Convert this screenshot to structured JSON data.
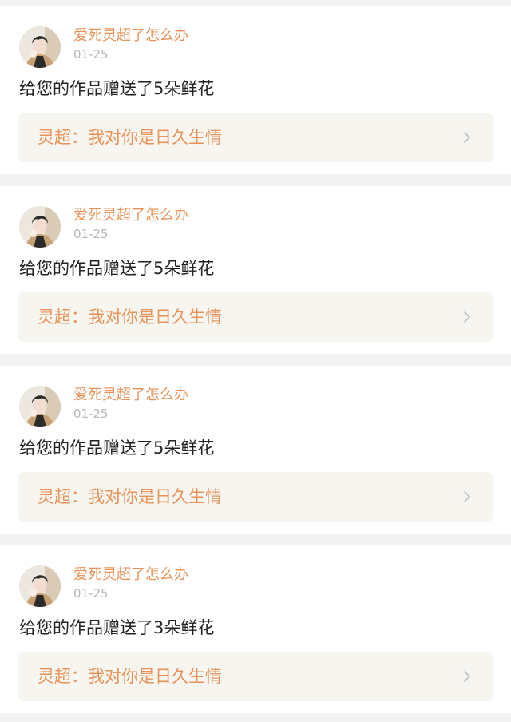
{
  "notifications": [
    {
      "username": "爱死灵超了怎么办",
      "date": "01-25",
      "message": "给您的作品赠送了5朵鲜花",
      "work_title": "灵超：我对你是日久生情",
      "avatar_icon": "user-avatar",
      "chevron_icon": "chevron-right-icon"
    },
    {
      "username": "爱死灵超了怎么办",
      "date": "01-25",
      "message": "给您的作品赠送了5朵鲜花",
      "work_title": "灵超：我对你是日久生情",
      "avatar_icon": "user-avatar",
      "chevron_icon": "chevron-right-icon"
    },
    {
      "username": "爱死灵超了怎么办",
      "date": "01-25",
      "message": "给您的作品赠送了5朵鲜花",
      "work_title": "灵超：我对你是日久生情",
      "avatar_icon": "user-avatar",
      "chevron_icon": "chevron-right-icon"
    },
    {
      "username": "爱死灵超了怎么办",
      "date": "01-25",
      "message": "给您的作品赠送了3朵鲜花",
      "work_title": "灵超：我对你是日久生情",
      "avatar_icon": "user-avatar",
      "chevron_icon": "chevron-right-icon"
    }
  ],
  "colors": {
    "accent": "#e8935a",
    "card_background": "#ffffff",
    "page_background": "#f2f2f2",
    "link_box_background": "#f6f5ef",
    "date_gray": "#b8b8b8",
    "text_dark": "#222222"
  }
}
